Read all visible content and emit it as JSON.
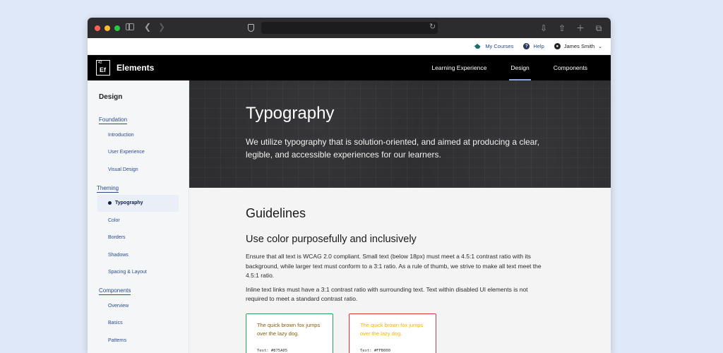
{
  "browser": {
    "traffic_colors": [
      "#ff5f57",
      "#febc2e",
      "#28c840"
    ]
  },
  "utility": {
    "courses": "My Courses",
    "help": "Help",
    "user": "James Smith"
  },
  "nav": {
    "brand": "Elements",
    "logo_number": "42",
    "logo_symbol": "Ef",
    "links": [
      "Learning Experience",
      "Design",
      "Components"
    ],
    "active": "Design"
  },
  "sidebar": {
    "title": "Design",
    "foundation": {
      "label": "Foundation",
      "items": [
        "Introduction",
        "User Experience",
        "Visual Design"
      ]
    },
    "theming": {
      "label": "Theming",
      "items": [
        "Typography",
        "Color",
        "Borders",
        "Shadows",
        "Spacing & Layout"
      ]
    },
    "components": {
      "label": "Components",
      "items": [
        "Overview",
        "Basics",
        "Patterns"
      ]
    },
    "active_item": "Typography"
  },
  "hero": {
    "title": "Typography",
    "text": "We utilize typography that is solution-oriented, and aimed at producing a clear, legible, and accessible experiences for our learners."
  },
  "main": {
    "heading": "Guidelines",
    "subheading": "Use color purposefully and inclusively",
    "para1": "Ensure that all text is WCAG 2.0 compliant. Small text (below 18px) must meet a 4.5:1 contrast ratio with its background, while larger text must conform to a 3:1 ratio. As a rule of thumb, we strive to make all text meet the 4.5:1 ratio.",
    "para2": "Inline text links must have a 3:1 contrast ratio with surrounding text. Text within disabled UI elements is not required to meet a standard contrast ratio.",
    "samples": [
      {
        "text": "The quick brown fox jumps over the lazy dog.",
        "code": "Text: #875A05",
        "text_color": "#875A05",
        "border_color": "#2e9e5b"
      },
      {
        "text": "The quick brown fox jumps over the lazy dog.",
        "code": "Text: #FFB000",
        "text_color": "#FFB000",
        "border_color": "#e0333a"
      }
    ]
  }
}
